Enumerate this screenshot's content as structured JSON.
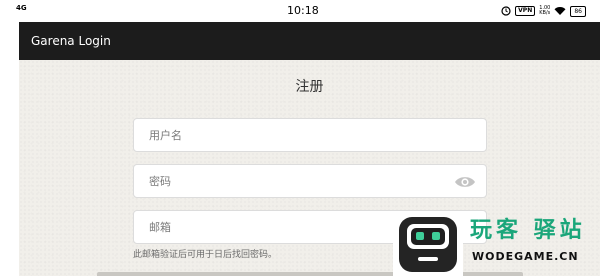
{
  "status_bar": {
    "network": "4G",
    "time": "10:18",
    "vpn": "VPN",
    "speed_value": "1.00",
    "speed_unit": "KB/s",
    "battery": "86"
  },
  "app_bar": {
    "title": "Garena Login"
  },
  "register_form": {
    "title": "注册",
    "username": {
      "placeholder": "用户名",
      "value": ""
    },
    "password": {
      "placeholder": "密码",
      "value": ""
    },
    "email": {
      "placeholder": "邮箱",
      "value": ""
    },
    "email_hint": "此邮箱验证后可用于日后找回密码。"
  },
  "watermark": {
    "brand": "玩客 驿站",
    "domain": "WODEGAME.CN",
    "brand_color": "#1aa67a"
  },
  "icons": {
    "password_toggle": "eye-icon",
    "vpn": "vpn-icon",
    "wifi": "wifi-icon",
    "battery": "battery-icon"
  }
}
